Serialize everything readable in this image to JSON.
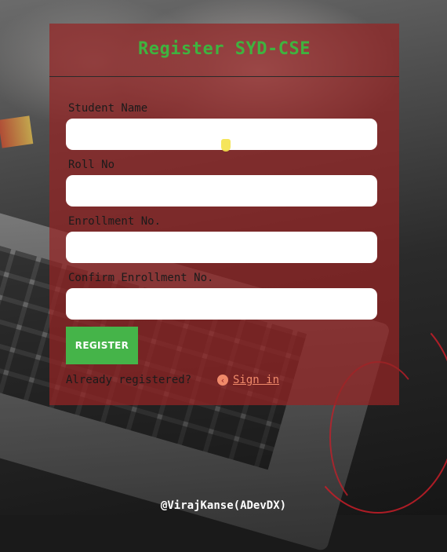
{
  "form": {
    "title": "Register SYD-CSE",
    "fields": [
      {
        "label": "Student Name",
        "value": "",
        "placeholder": ""
      },
      {
        "label": "Roll No",
        "value": "",
        "placeholder": ""
      },
      {
        "label": "Enrollment No.",
        "value": "",
        "placeholder": ""
      },
      {
        "label": "Confirm Enrollment No.",
        "value": "",
        "placeholder": ""
      }
    ],
    "register_label": "REGISTER",
    "already_text": "Already registered?",
    "signin_label": "Sign in",
    "signin_icon": "chevron-left-circle-icon"
  },
  "footer": {
    "credit": "@VirajKanse(ADevDX)"
  },
  "colors": {
    "card_bg": "#962424",
    "title": "#3fb33f",
    "button": "#45b449",
    "link": "#f08a6a"
  }
}
